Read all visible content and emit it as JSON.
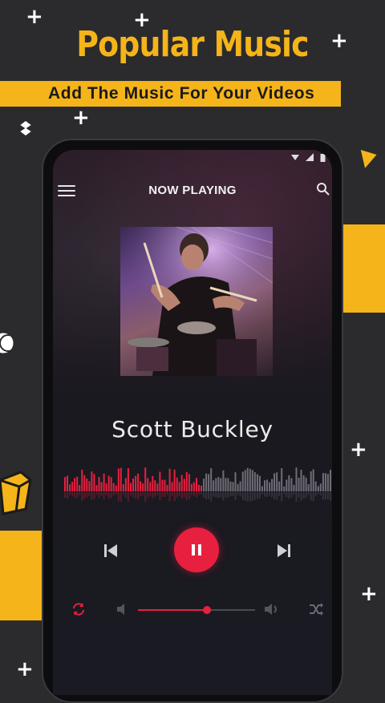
{
  "promo": {
    "title": "Popular Music",
    "subtitle": "Add The Music For Your Videos"
  },
  "colors": {
    "accent": "#e8203f",
    "brand_yellow": "#f4b41a",
    "background": "#2b2b2d"
  },
  "player": {
    "header_title": "NOW PLAYING",
    "artist": "Scott Buckley",
    "playback_state": "playing",
    "progress_fraction": 0.51,
    "volume_fraction": 0.59
  },
  "icons": {
    "menu": "hamburger-menu-icon",
    "search": "search-icon",
    "previous": "skip-previous-icon",
    "play_pause": "pause-icon",
    "next": "skip-next-icon",
    "repeat": "repeat-icon",
    "volume_low": "volume-low-icon",
    "volume_high": "volume-high-icon",
    "shuffle": "shuffle-icon"
  }
}
